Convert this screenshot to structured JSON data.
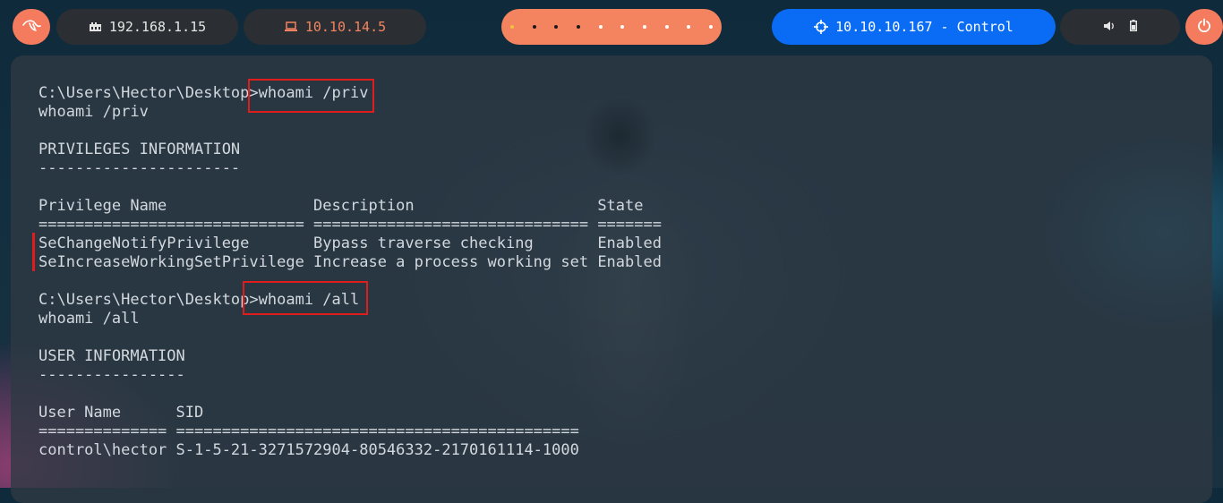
{
  "topbar": {
    "local_ip": "192.168.1.15",
    "vpn_ip": "10.10.14.5",
    "target": "10.10.10.167 - Control",
    "launcher_icon": "kali-dragon-icon",
    "power_icon": "power-icon",
    "colors": {
      "accent": "#f47b5e",
      "target_bg": "#0a6cf5",
      "pill_bg": "#2b2f33"
    }
  },
  "terminal": {
    "prompt1": "C:\\Users\\Hector\\Desktop>",
    "cmd1": "whoami /priv",
    "echo1": "whoami /priv",
    "priv_header": "PRIVILEGES INFORMATION",
    "priv_underline": "----------------------",
    "col_headers": "Privilege Name                Description                    State",
    "col_sep": "============================= ============================== =======",
    "privileges": [
      "SeChangeNotifyPrivilege       Bypass traverse checking       Enabled",
      "SeIncreaseWorkingSetPrivilege Increase a process working set Enabled"
    ],
    "prompt2": "C:\\Users\\Hector\\Desktop>",
    "cmd2": "whoami /all",
    "echo2": "whoami /all",
    "user_header": "USER INFORMATION",
    "user_underline": "----------------",
    "user_cols": "User Name      SID",
    "user_sep": "============== ============================================",
    "user_row": "control\\hector S-1-5-21-3271572904-80546332-2170161114-1000"
  }
}
